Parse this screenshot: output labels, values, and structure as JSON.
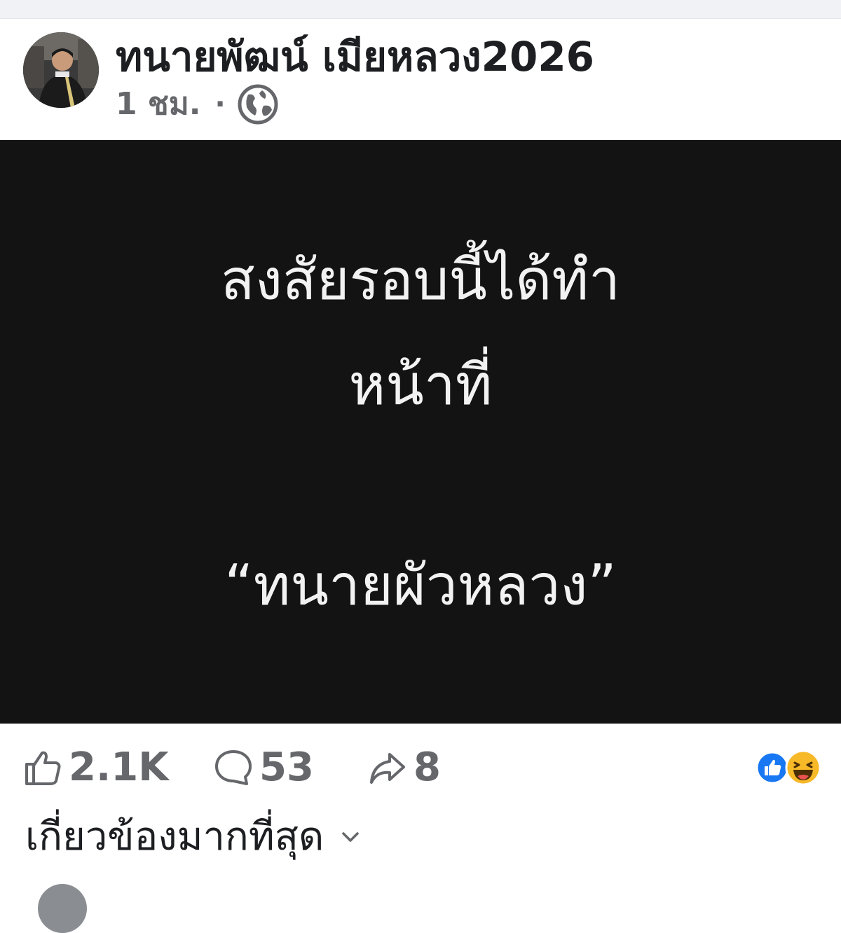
{
  "post": {
    "author_name": "ทนายพัฒน์ เมียหลวง2026",
    "time": "1 ชม.",
    "separator": "·",
    "privacy_icon": "globe-icon",
    "content_lines": [
      "สงสัยรอบนี้ได้ทำ",
      "หน้าที่",
      "“ทนายผัวหลวง”"
    ],
    "content_background": "#131313",
    "content_text_color": "#f2f2f2"
  },
  "stats": {
    "likes": "2.1K",
    "comments": "53",
    "shares": "8",
    "reactions": [
      "like-reaction-icon",
      "haha-reaction-icon"
    ]
  },
  "comments": {
    "sort_label": "เกี่ยวข้องมากที่สุด"
  },
  "colors": {
    "like_blue": "#1877f2",
    "haha_yellow": "#f7b928",
    "muted_text": "#65676b"
  }
}
